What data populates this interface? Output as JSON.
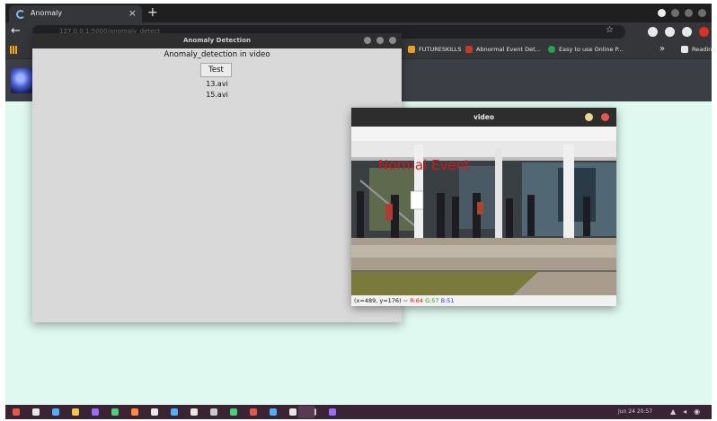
{
  "browser": {
    "tab_title": "Anomaly",
    "tab_close": "×",
    "new_tab": "+",
    "back": "←",
    "url": "127.0.0.1:5000/anomaly_detect",
    "star": "☆",
    "bookmarks": [
      {
        "label": "FUTURESKILLS",
        "icon": "arrow-icon",
        "color": "#f0a020"
      },
      {
        "label": "Abnormal Event Det...",
        "icon": "page-icon",
        "color": "#c23a2a"
      },
      {
        "label": "Easy to use Online P...",
        "icon": "globe-icon",
        "color": "#23a455"
      }
    ],
    "bookmarks_more": "»",
    "reading_list": "Reading list"
  },
  "anomaly_window": {
    "title": "Anomaly Detection",
    "heading": "Anomaly_detection in video",
    "test_button": "Test",
    "files": [
      "13.avi",
      "15.avi"
    ]
  },
  "video_window": {
    "title": "video",
    "overlay_text": "Normal Event",
    "status": {
      "coords": "(x=489, y=176) ~",
      "r": "R:64",
      "g": "G:57",
      "b": "B:51"
    }
  },
  "taskbar": {
    "clock": "Jun 24 20:57",
    "icons": [
      "#e5574b",
      "#e8e8e8",
      "#4fb0ff",
      "#f3c843",
      "#9b6cff",
      "#4ad07a",
      "#ff8a3d",
      "#e8e8e8",
      "#4fb0ff",
      "#e8e8e8",
      "#c9c9c9",
      "#4ad07a",
      "#e5574b",
      "#4fb0ff",
      "#e8e8e8",
      "#c9c9c9",
      "#9b6cff"
    ]
  },
  "colors": {
    "page_background": "#dff8f0",
    "overlay_red": "#d11a1a"
  }
}
